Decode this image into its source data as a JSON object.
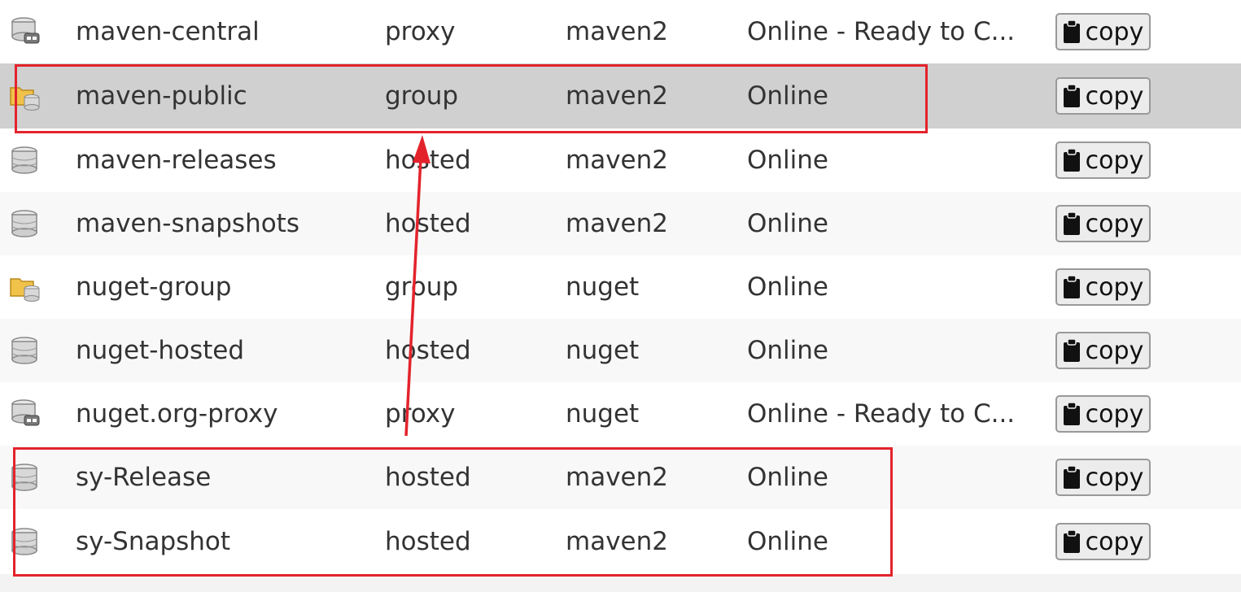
{
  "rows": [
    {
      "name": "maven-central",
      "type": "proxy",
      "format": "maven2",
      "status": "Online - Ready to C...",
      "icon": "proxy-db-icon",
      "copy_label": "copy"
    },
    {
      "name": "maven-public",
      "type": "group",
      "format": "maven2",
      "status": "Online",
      "icon": "group-folder-icon",
      "copy_label": "copy"
    },
    {
      "name": "maven-releases",
      "type": "hosted",
      "format": "maven2",
      "status": "Online",
      "icon": "database-icon",
      "copy_label": "copy"
    },
    {
      "name": "maven-snapshots",
      "type": "hosted",
      "format": "maven2",
      "status": "Online",
      "icon": "database-icon",
      "copy_label": "copy"
    },
    {
      "name": "nuget-group",
      "type": "group",
      "format": "nuget",
      "status": "Online",
      "icon": "group-folder-icon",
      "copy_label": "copy"
    },
    {
      "name": "nuget-hosted",
      "type": "hosted",
      "format": "nuget",
      "status": "Online",
      "icon": "database-icon",
      "copy_label": "copy"
    },
    {
      "name": "nuget.org-proxy",
      "type": "proxy",
      "format": "nuget",
      "status": "Online - Ready to C...",
      "icon": "proxy-db-icon",
      "copy_label": "copy"
    },
    {
      "name": "sy-Release",
      "type": "hosted",
      "format": "maven2",
      "status": "Online",
      "icon": "database-icon",
      "copy_label": "copy"
    },
    {
      "name": "sy-Snapshot",
      "type": "hosted",
      "format": "maven2",
      "status": "Online",
      "icon": "database-icon",
      "copy_label": "copy"
    }
  ],
  "colors": {
    "annotation": "#e3232c",
    "selected_row": "#d0d0d0",
    "text": "#333333"
  }
}
